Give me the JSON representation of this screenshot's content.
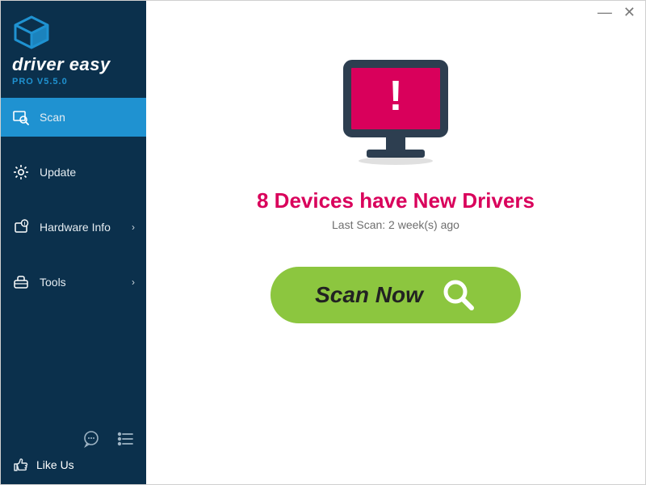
{
  "brand": {
    "name": "driver easy",
    "version_prefix": "PRO V",
    "version": "5.5.0"
  },
  "sidebar": {
    "items": [
      {
        "label": "Scan",
        "icon": "magnifier",
        "active": true,
        "expandable": false
      },
      {
        "label": "Update",
        "icon": "gear",
        "active": false,
        "expandable": false
      },
      {
        "label": "Hardware Info",
        "icon": "chip-info",
        "active": false,
        "expandable": true
      },
      {
        "label": "Tools",
        "icon": "toolbox",
        "active": false,
        "expandable": true
      }
    ],
    "like_us_label": "Like Us"
  },
  "main": {
    "headline_prefix": "8",
    "headline_suffix": " Devices have New Drivers",
    "last_scan_label": "Last Scan: 2 week(s) ago",
    "scan_button_label": "Scan Now"
  },
  "colors": {
    "sidebar_bg": "#0b304c",
    "accent": "#1f92d1",
    "alert_red": "#d9005b",
    "scan_green": "#8cc63f",
    "monitor_dark": "#2d3e50"
  }
}
